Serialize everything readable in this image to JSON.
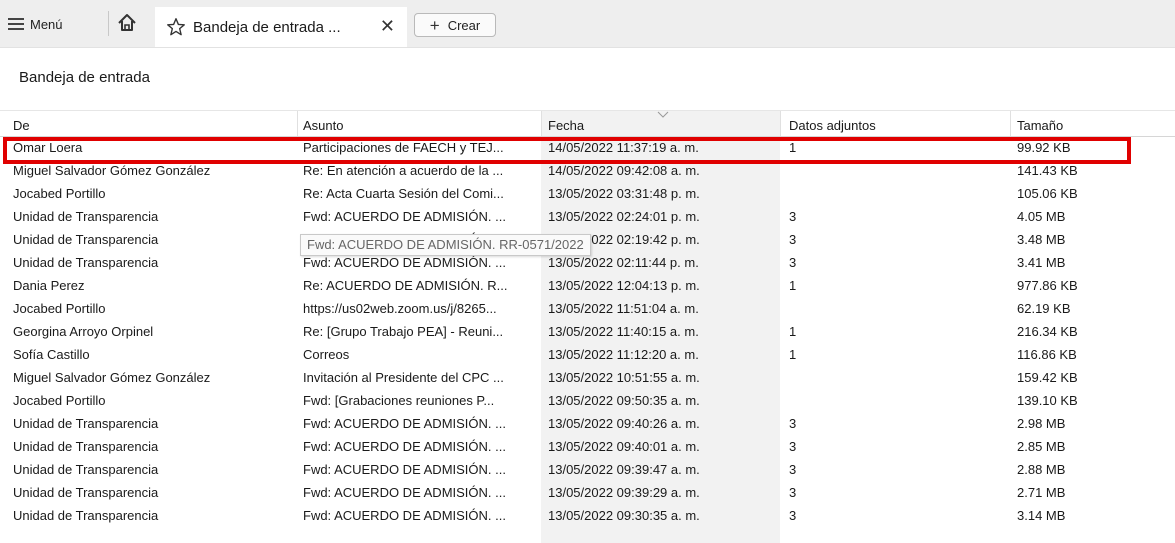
{
  "topbar": {
    "menu_label": "Menú",
    "tab_title": "Bandeja de entrada ...",
    "close_glyph": "✕",
    "create_label": "Crear",
    "create_glyph": "+",
    "icons": [
      "hamburger-icon",
      "home-icon",
      "star-icon",
      "close-icon",
      "plus-icon"
    ]
  },
  "folder_title": "Bandeja de entrada",
  "columns": {
    "de": "De",
    "asunto": "Asunto",
    "fecha": "Fecha",
    "adjuntos": "Datos adjuntos",
    "tamano": "Tamaño"
  },
  "rows": [
    {
      "de": "Omar Loera",
      "asunto": "Participaciones de FAECH y TEJ...",
      "fecha": "14/05/2022 11:37:19 a. m.",
      "adj": "1",
      "tam": "99.92 KB"
    },
    {
      "de": "Miguel Salvador Gómez González",
      "asunto": "Re: En atención a acuerdo de la ...",
      "fecha": "14/05/2022 09:42:08 a. m.",
      "adj": "",
      "tam": "141.43 KB"
    },
    {
      "de": "Jocabed Portillo",
      "asunto": "Re: Acta Cuarta Sesión del Comi...",
      "fecha": "13/05/2022 03:31:48 p. m.",
      "adj": "",
      "tam": "105.06 KB"
    },
    {
      "de": "Unidad de Transparencia",
      "asunto": "Fwd: ACUERDO DE ADMISIÓN. ...",
      "fecha": "13/05/2022 02:24:01 p. m.",
      "adj": "3",
      "tam": "4.05 MB"
    },
    {
      "de": "Unidad de Transparencia",
      "asunto": "Fwd: ACUERDO DE ADMISIÓN. ...",
      "fecha": "13/05/2022 02:19:42 p. m.",
      "adj": "3",
      "tam": "3.48 MB"
    },
    {
      "de": "Unidad de Transparencia",
      "asunto": "Fwd: ACUERDO DE ADMISIÓN. ...",
      "fecha": "13/05/2022 02:11:44 p. m.",
      "adj": "3",
      "tam": "3.41 MB"
    },
    {
      "de": "Dania Perez",
      "asunto": "Re: ACUERDO DE ADMISIÓN. R...",
      "fecha": "13/05/2022 12:04:13 p. m.",
      "adj": "1",
      "tam": "977.86 KB"
    },
    {
      "de": "Jocabed Portillo",
      "asunto": "https://us02web.zoom.us/j/8265...",
      "fecha": "13/05/2022 11:51:04 a. m.",
      "adj": "",
      "tam": "62.19 KB"
    },
    {
      "de": "Georgina Arroyo Orpinel",
      "asunto": "Re: [Grupo Trabajo PEA] - Reuni...",
      "fecha": "13/05/2022 11:40:15 a. m.",
      "adj": "1",
      "tam": "216.34 KB"
    },
    {
      "de": "Sofía Castillo",
      "asunto": "Correos",
      "fecha": "13/05/2022 11:12:20 a. m.",
      "adj": "1",
      "tam": "116.86 KB"
    },
    {
      "de": "Miguel Salvador Gómez González",
      "asunto": "Invitación al Presidente del CPC ...",
      "fecha": "13/05/2022 10:51:55 a. m.",
      "adj": "",
      "tam": "159.42 KB"
    },
    {
      "de": "Jocabed Portillo",
      "asunto": "Fwd: [Grabaciones reuniones P...",
      "fecha": "13/05/2022 09:50:35 a. m.",
      "adj": "",
      "tam": "139.10 KB"
    },
    {
      "de": "Unidad de Transparencia",
      "asunto": "Fwd: ACUERDO DE ADMISIÓN. ...",
      "fecha": "13/05/2022 09:40:26 a. m.",
      "adj": "3",
      "tam": "2.98 MB"
    },
    {
      "de": "Unidad de Transparencia",
      "asunto": "Fwd: ACUERDO DE ADMISIÓN. ...",
      "fecha": "13/05/2022 09:40:01 a. m.",
      "adj": "3",
      "tam": "2.85 MB"
    },
    {
      "de": "Unidad de Transparencia",
      "asunto": "Fwd: ACUERDO DE ADMISIÓN. ...",
      "fecha": "13/05/2022 09:39:47 a. m.",
      "adj": "3",
      "tam": "2.88 MB"
    },
    {
      "de": "Unidad de Transparencia",
      "asunto": "Fwd: ACUERDO DE ADMISIÓN. ...",
      "fecha": "13/05/2022 09:39:29 a. m.",
      "adj": "3",
      "tam": "2.71 MB"
    },
    {
      "de": "Unidad de Transparencia",
      "asunto": "Fwd: ACUERDO DE ADMISIÓN. ...",
      "fecha": "13/05/2022 09:30:35 a. m.",
      "adj": "3",
      "tam": "3.14 MB"
    }
  ],
  "tooltip": "Fwd: ACUERDO DE ADMISIÓN. RR-0571/2022",
  "colors": {
    "highlight": "#e00000",
    "fecha_column": "#f2f2f2",
    "topbar": "#eeeeee"
  }
}
